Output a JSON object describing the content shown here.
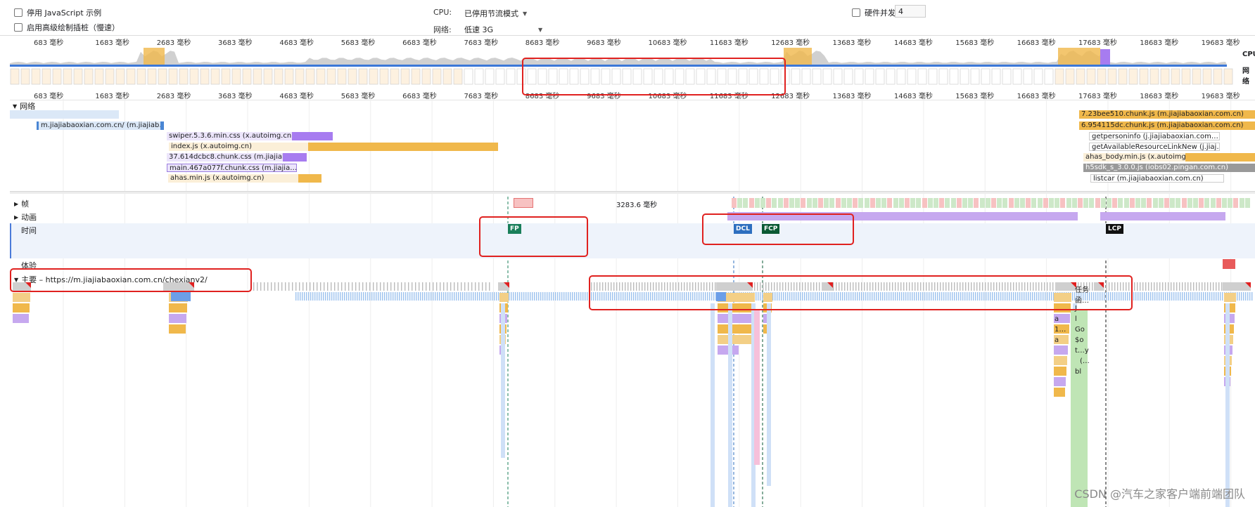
{
  "settings": {
    "disable_js_label": "停用 JavaScript 示例",
    "advanced_paint_label": "启用高级绘制插桩（慢速）",
    "cpu_label": "CPU:",
    "cpu_value": "已停用节流模式",
    "network_label": "网络:",
    "network_value": "低速 3G",
    "hw_concurrency_label": "硬件并发",
    "hw_concurrency_value": "4"
  },
  "overview": {
    "cpu_label": "CPU",
    "net_label": "网络",
    "ticks": [
      "683 毫秒",
      "1683 毫秒",
      "2683 毫秒",
      "3683 毫秒",
      "4683 毫秒",
      "5683 毫秒",
      "6683 毫秒",
      "7683 毫秒",
      "8683 毫秒",
      "9683 毫秒",
      "10683 毫秒",
      "11683 毫秒",
      "12683 毫秒",
      "13683 毫秒",
      "14683 毫秒",
      "15683 毫秒",
      "16683 毫秒",
      "17683 毫秒",
      "18683 毫秒",
      "19683 毫秒"
    ]
  },
  "ruler": {
    "ticks": [
      "683 毫秒",
      "1683 毫秒",
      "2683 毫秒",
      "3683 毫秒",
      "4683 毫秒",
      "5683 毫秒",
      "6683 毫秒",
      "7683 毫秒",
      "8683 毫秒",
      "9683 毫秒",
      "10683 毫秒",
      "11683 毫秒",
      "12683 毫秒",
      "13683 毫秒",
      "14683 毫秒",
      "15683 毫秒",
      "16683 毫秒",
      "17683 毫秒",
      "18683 毫秒",
      "19683 毫秒"
    ]
  },
  "network": {
    "title": "网络",
    "left_rows": [
      "m.jiajiabaoxian.com.cn/ (m.jiajiab…",
      "swiper.5.3.6.min.css (x.autoimg.cn)",
      "index.js (x.autoimg.cn)",
      "37.614dcbc8.chunk.css (m.jiajiabaox…",
      "main.467a077f.chunk.css (m.jiajia…",
      "ahas.min.js (x.autoimg.cn)"
    ],
    "right_rows": [
      "7.23bee510.chunk.js (m.jiajiabaoxian.com.cn)",
      "6.954115dc.chunk.js (m.jiajiabaoxian.com.cn)",
      "getpersoninfo (j.jiajiabaoxian.com….",
      "getAvailableResourceLinkNew (j.jiaj…",
      "ahas_body.min.js (x.autoimg.cn)",
      "h5sdk_s_3.0.0.js (iobs02.pingan.com.cn)",
      "listcar (m.jiajiabaoxian.com.cn)"
    ]
  },
  "tracks": {
    "frames": "帧",
    "frames_duration": "3283.6 毫秒",
    "animation": "动画",
    "timings": "时间",
    "experience": "体验",
    "main": "主要 – https://m.jiajiabaoxian.com.cn/chexianv2/"
  },
  "markers": {
    "fp": "FP",
    "dcl": "DCL",
    "fcp": "FCP",
    "lcp": "LCP"
  },
  "flame_labels": [
    "任务",
    "函…",
    "J…",
    "a",
    "l",
    "1…",
    "Go",
    "a",
    "$o",
    "t…y",
    "(…",
    "bl"
  ],
  "watermark": "CSDN @汽车之家客户端前端团队",
  "colors": {
    "fp": "#1a7f5a",
    "dcl": "#2e6fbf",
    "fcp": "#0b5a34",
    "lcp": "#111111",
    "annotation": "#e0211f",
    "script": "#f0b84b",
    "render": "#a77cf0",
    "network_bar": "#9cc2ee",
    "frames": "#cde8c8"
  }
}
